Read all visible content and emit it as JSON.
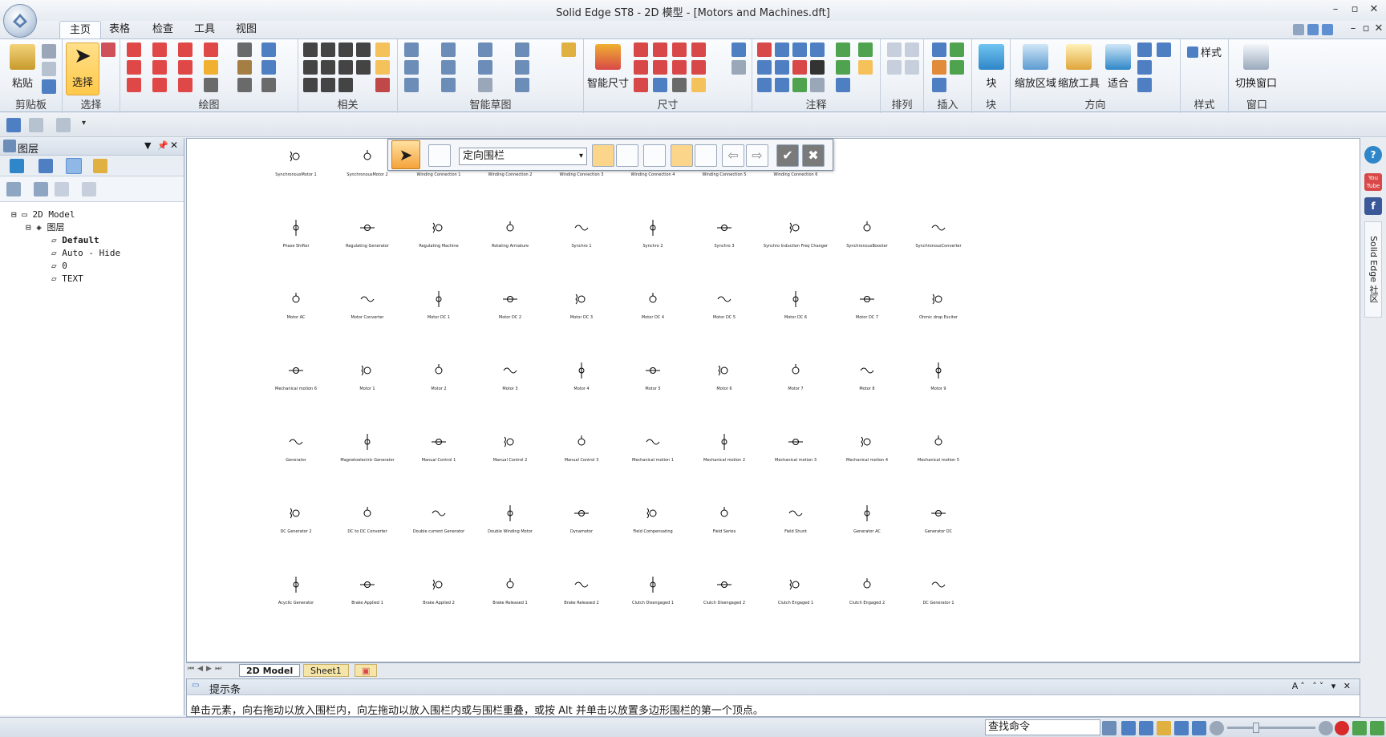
{
  "window": {
    "title": "Solid Edge ST8 - 2D 模型 - [Motors and Machines.dft]"
  },
  "ribbon_tabs": [
    {
      "label": "主页",
      "active": true
    },
    {
      "label": "表格",
      "active": false
    },
    {
      "label": "检查",
      "active": false
    },
    {
      "label": "工具",
      "active": false
    },
    {
      "label": "视图",
      "active": false
    }
  ],
  "groups": {
    "clipboard": "剪贴板",
    "select": "选择",
    "draw": "绘图",
    "relate": "相关",
    "smart_sketch": "智能草图",
    "dimension": "尺寸",
    "annotation": "注释",
    "arrange": "排列",
    "insert": "插入",
    "block": "块",
    "orient": "方向",
    "style": "样式",
    "window": "窗口"
  },
  "buttons": {
    "paste": "粘贴",
    "select": "选择",
    "smart_dimension": "智能尺寸",
    "block": "块",
    "zoom_area": "缩放区域",
    "zoom_tool": "缩放工具",
    "fit": "适合",
    "style": "样式",
    "switch_window": "切换窗口"
  },
  "layers_panel": {
    "title": "图层",
    "tree": [
      {
        "label": "2D Model",
        "level": 0
      },
      {
        "label": "图层",
        "level": 1
      },
      {
        "label": "Default",
        "level": 2,
        "bold": true
      },
      {
        "label": "Auto - Hide",
        "level": 2
      },
      {
        "label": "0",
        "level": 2
      },
      {
        "label": "TEXT",
        "level": 2
      }
    ]
  },
  "fence_toolbar": {
    "mode": "定向围栏"
  },
  "symbols": [
    [
      "SynchronousMotor 1",
      "SynchronousMotor 2",
      "Winding Connection 1",
      "Winding Connection 2",
      "Winding Connection 3",
      "Winding Connection 4",
      "Winding Connection 5",
      "Winding Connection 6",
      "",
      ""
    ],
    [
      "Phase Shifter",
      "Regulating Generator",
      "Regulating Machine",
      "Rotating Armature",
      "Synchro 1",
      "Synchro 2",
      "Synchro 3",
      "Synchro Induction Freq Changer",
      "SynchronousBooster",
      "SynchronousConverter"
    ],
    [
      "Motor AC",
      "Motor Converter",
      "Motor DC 1",
      "Motor DC 2",
      "Motor DC 3",
      "Motor DC 4",
      "Motor DC 5",
      "Motor DC 6",
      "Motor DC 7",
      "Ohmic drop Exciter"
    ],
    [
      "Mechanical motion 6",
      "Motor 1",
      "Motor 2",
      "Motor 3",
      "Motor 4",
      "Motor 5",
      "Motor 6",
      "Motor 7",
      "Motor 8",
      "Motor 9"
    ],
    [
      "Generator",
      "Magnetoelectric Generator",
      "Manual Control 1",
      "Manual Control 2",
      "Manual Control 3",
      "Mechanical motion 1",
      "Mechanical motion 2",
      "Mechanical motion 3",
      "Mechanical motion 4",
      "Mechanical motion 5"
    ],
    [
      "DC Generator 2",
      "DC to DC Converter",
      "Double current Generator",
      "Double Winding Motor",
      "Dynamotor",
      "Field Compensating",
      "Field Series",
      "Field Shunt",
      "Generator AC",
      "Generator DC"
    ],
    [
      "Acyclic Generator",
      "Brake Applied 1",
      "Brake Applied 2",
      "Brake Released 1",
      "Brake Released 2",
      "Clutch Disengaged 1",
      "Clutch Disengaged 2",
      "Clutch Engaged 1",
      "Clutch Engaged 2",
      "DC Generator 1"
    ]
  ],
  "sheet_tabs": [
    {
      "label": "2D Model",
      "active": true
    },
    {
      "label": "Sheet1",
      "active": false
    }
  ],
  "prompt_bar": {
    "title": "提示条",
    "text": "单击元素，向右拖动以放入围栏内，向左拖动以放入围栏内或与围栏重叠，或按 Alt 并单击以放置多边形围栏的第一个顶点。"
  },
  "status": {
    "find_command": "查找命令"
  },
  "right_strip": {
    "social": "You Tube",
    "community": "Solid Edge 社区"
  },
  "colors": {
    "accent": "#ffc94a",
    "ribbon_bg": "#eef2f7",
    "selected": "#f5a33a"
  }
}
